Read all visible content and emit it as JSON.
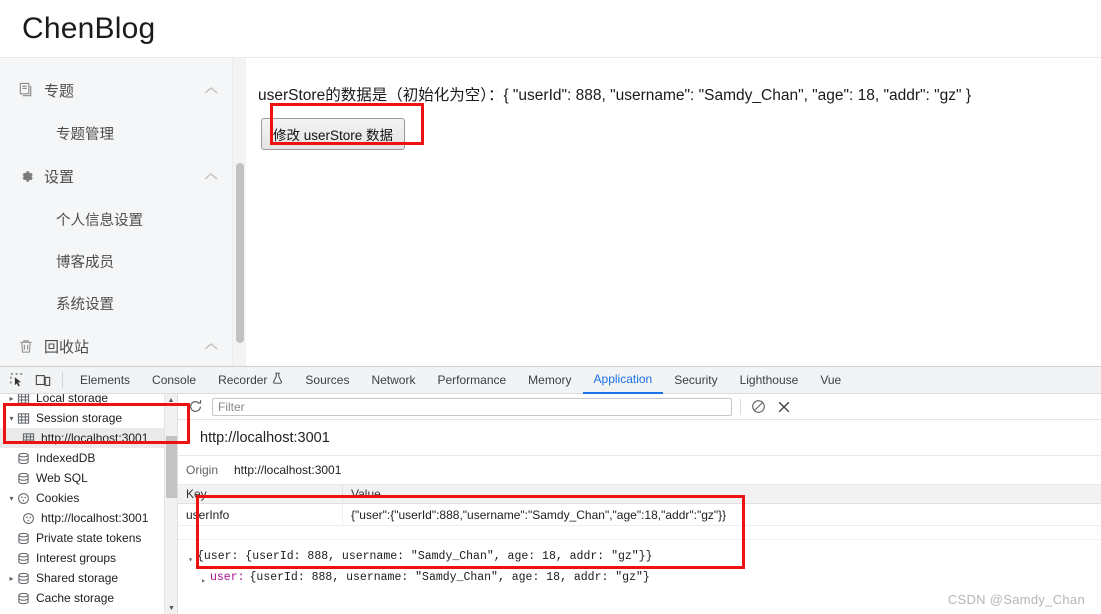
{
  "app": {
    "brand": "ChenBlog",
    "sidebar": {
      "items": [
        {
          "label": "专题",
          "icon": "documents-icon",
          "type": "group",
          "chevron": "chevron-up-icon"
        },
        {
          "label": "专题管理",
          "icon": "",
          "type": "child",
          "chevron": ""
        },
        {
          "label": "设置",
          "icon": "gear-icon",
          "type": "group",
          "chevron": "chevron-up-icon"
        },
        {
          "label": "个人信息设置",
          "icon": "",
          "type": "child",
          "chevron": ""
        },
        {
          "label": "博客成员",
          "icon": "",
          "type": "child",
          "chevron": ""
        },
        {
          "label": "系统设置",
          "icon": "",
          "type": "child",
          "chevron": ""
        },
        {
          "label": "回收站",
          "icon": "trash-icon",
          "type": "group",
          "chevron": "chevron-up-icon"
        }
      ]
    },
    "main": {
      "store_line": "userStore的数据是（初始化为空）：{ \"userId\": 888, \"username\": \"Samdy_Chan\", \"age\": 18, \"addr\": \"gz\" }",
      "button_label": "修改 userStore 数据"
    }
  },
  "devtools": {
    "toolbar_icons": [
      "inspect-element-icon",
      "device-toolbar-icon"
    ],
    "tabs": [
      {
        "label": "Elements",
        "active": false
      },
      {
        "label": "Console",
        "active": false
      },
      {
        "label": "Recorder",
        "active": false,
        "suffix_icon": "flask-icon"
      },
      {
        "label": "Sources",
        "active": false
      },
      {
        "label": "Network",
        "active": false
      },
      {
        "label": "Performance",
        "active": false
      },
      {
        "label": "Memory",
        "active": false
      },
      {
        "label": "Application",
        "active": true
      },
      {
        "label": "Security",
        "active": false
      },
      {
        "label": "Lighthouse",
        "active": false
      },
      {
        "label": "Vue",
        "active": false
      }
    ],
    "tree": [
      {
        "label": "Local storage",
        "icon": "table-icon",
        "twisty": "collapsed",
        "indent": false,
        "selected": false
      },
      {
        "label": "Session storage",
        "icon": "table-icon",
        "twisty": "expanded",
        "indent": false,
        "selected": false
      },
      {
        "label": "http://localhost:3001",
        "icon": "table-icon",
        "twisty": "none",
        "indent": true,
        "selected": true
      },
      {
        "label": "IndexedDB",
        "icon": "database-icon",
        "twisty": "none",
        "indent": false,
        "selected": false
      },
      {
        "label": "Web SQL",
        "icon": "database-icon",
        "twisty": "none",
        "indent": false,
        "selected": false
      },
      {
        "label": "Cookies",
        "icon": "cookie-icon",
        "twisty": "expanded",
        "indent": false,
        "selected": false
      },
      {
        "label": "http://localhost:3001",
        "icon": "cookie-icon",
        "twisty": "none",
        "indent": true,
        "selected": false
      },
      {
        "label": "Private state tokens",
        "icon": "database-icon",
        "twisty": "none",
        "indent": false,
        "selected": false
      },
      {
        "label": "Interest groups",
        "icon": "database-icon",
        "twisty": "none",
        "indent": false,
        "selected": false
      },
      {
        "label": "Shared storage",
        "icon": "database-icon",
        "twisty": "collapsed",
        "indent": false,
        "selected": false
      },
      {
        "label": "Cache storage",
        "icon": "database-icon",
        "twisty": "none",
        "indent": false,
        "selected": false
      }
    ],
    "filterbar": {
      "refresh_icon": "refresh-icon",
      "filter_placeholder": "Filter",
      "filter_value": "",
      "clear_all_icon": "clear-all-icon",
      "delete_selected_icon": "delete-selected-icon"
    },
    "panel": {
      "origin_title": "http://localhost:3001",
      "origin_key": "Origin",
      "origin_value": "http://localhost:3001",
      "table": {
        "headers": [
          "Key",
          "Value"
        ],
        "rows": [
          {
            "key": "userInfo",
            "value": "{\"user\":{\"userId\":888,\"username\":\"Samdy_Chan\",\"age\":18,\"addr\":\"gz\"}}"
          }
        ]
      },
      "preview": {
        "line1": "{user: {userId: 888, username: \"Samdy_Chan\", age: 18, addr: \"gz\"}}",
        "line2_key": "user:",
        "line2_value": "{userId: 888, username: \"Samdy_Chan\", age: 18, addr: \"gz\"}"
      }
    }
  },
  "watermark": "CSDN @Samdy_Chan",
  "colors": {
    "accent": "#1a73e8",
    "annotation": "#ee1111",
    "sidebar_bg": "#f5f6f7",
    "devtools_bg": "#f1f3f4"
  }
}
